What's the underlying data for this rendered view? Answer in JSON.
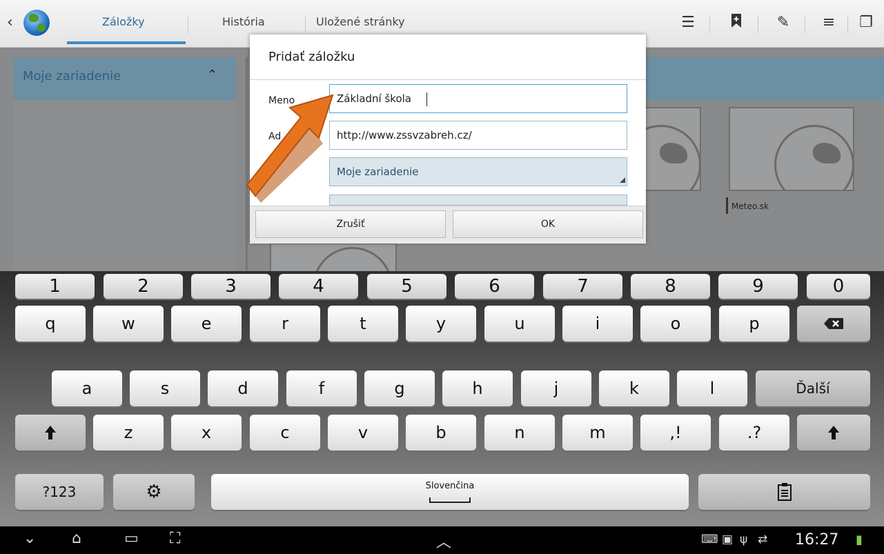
{
  "browser_tabs": {
    "bookmarks": "Záložky",
    "history": "História",
    "saved_pages": "Uložené stránky"
  },
  "sidebar": {
    "folder_title": "Moje zariadenie"
  },
  "bookmarks_grid": {
    "thumbnail_label": "Meteo.sk"
  },
  "dialog": {
    "title": "Pridať záložku",
    "name_label": "Meno",
    "address_label": "Ad",
    "name_value": "Základní škola",
    "address_value": "http://www.zssvzabreh.cz/",
    "folder_value": "Moje zariadenie",
    "cancel_label": "Zrušiť",
    "ok_label": "OK"
  },
  "keyboard": {
    "numbers": [
      "1",
      "2",
      "3",
      "4",
      "5",
      "6",
      "7",
      "8",
      "9",
      "0"
    ],
    "row1": [
      "q",
      "w",
      "e",
      "r",
      "t",
      "y",
      "u",
      "i",
      "o",
      "p"
    ],
    "row2": [
      "a",
      "s",
      "d",
      "f",
      "g",
      "h",
      "j",
      "k",
      "l"
    ],
    "row3": [
      "z",
      "x",
      "c",
      "v",
      "b",
      "n",
      "m"
    ],
    "comma_key": ",!",
    "period_key": ".?",
    "next_label": "Ďalší",
    "symbols_label": "?123",
    "space_label": "Slovenčina"
  },
  "status_bar": {
    "time": "16:27"
  },
  "colors": {
    "accent": "#3d8ac7",
    "arrow": "#e8731f"
  }
}
